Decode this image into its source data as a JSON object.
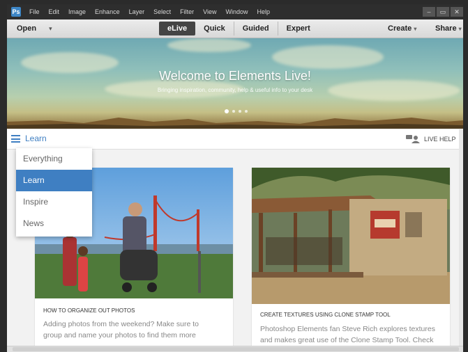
{
  "menubar": {
    "logo": "Ps",
    "items": [
      "File",
      "Edit",
      "Image",
      "Enhance",
      "Layer",
      "Select",
      "Filter",
      "View",
      "Window",
      "Help"
    ],
    "controls": [
      "–",
      "▭",
      "✕"
    ]
  },
  "toolbar": {
    "open_label": "Open",
    "open_caret": "▾",
    "modes": [
      "eLive",
      "Quick",
      "Guided",
      "Expert"
    ],
    "active_mode": "eLive",
    "create_label": "Create",
    "share_label": "Share",
    "caret": "▾"
  },
  "hero": {
    "title": "Welcome to Elements Live!",
    "subtitle": "Bringing inspiration, community, help & useful info to your desk",
    "slide_count": 4,
    "active_slide": 1
  },
  "learnbar": {
    "label": "Learn",
    "live_help": "LIVE HELP"
  },
  "dropdown": {
    "items": [
      "Everything",
      "Learn",
      "Inspire",
      "News"
    ],
    "active": "Learn"
  },
  "cards": [
    {
      "title": "HOW TO ORGANIZE OUT PHOTOS",
      "text_1": "Adding photos from the weekend? Make sure to",
      "text_2": "group and name your photos to find them more"
    },
    {
      "title": "CREATE TEXTURES USING CLONE STAMP TOOL",
      "text_1": "Photoshop Elements fan Steve Rich explores textures",
      "text_2": "and makes great use of the Clone Stamp Tool. Check"
    }
  ],
  "colors": {
    "accent": "#3f7fc2",
    "menubar": "#2e2e2e"
  },
  "icons": [
    "hamburger-icon",
    "chat-users-icon",
    "app-logo-icon"
  ]
}
